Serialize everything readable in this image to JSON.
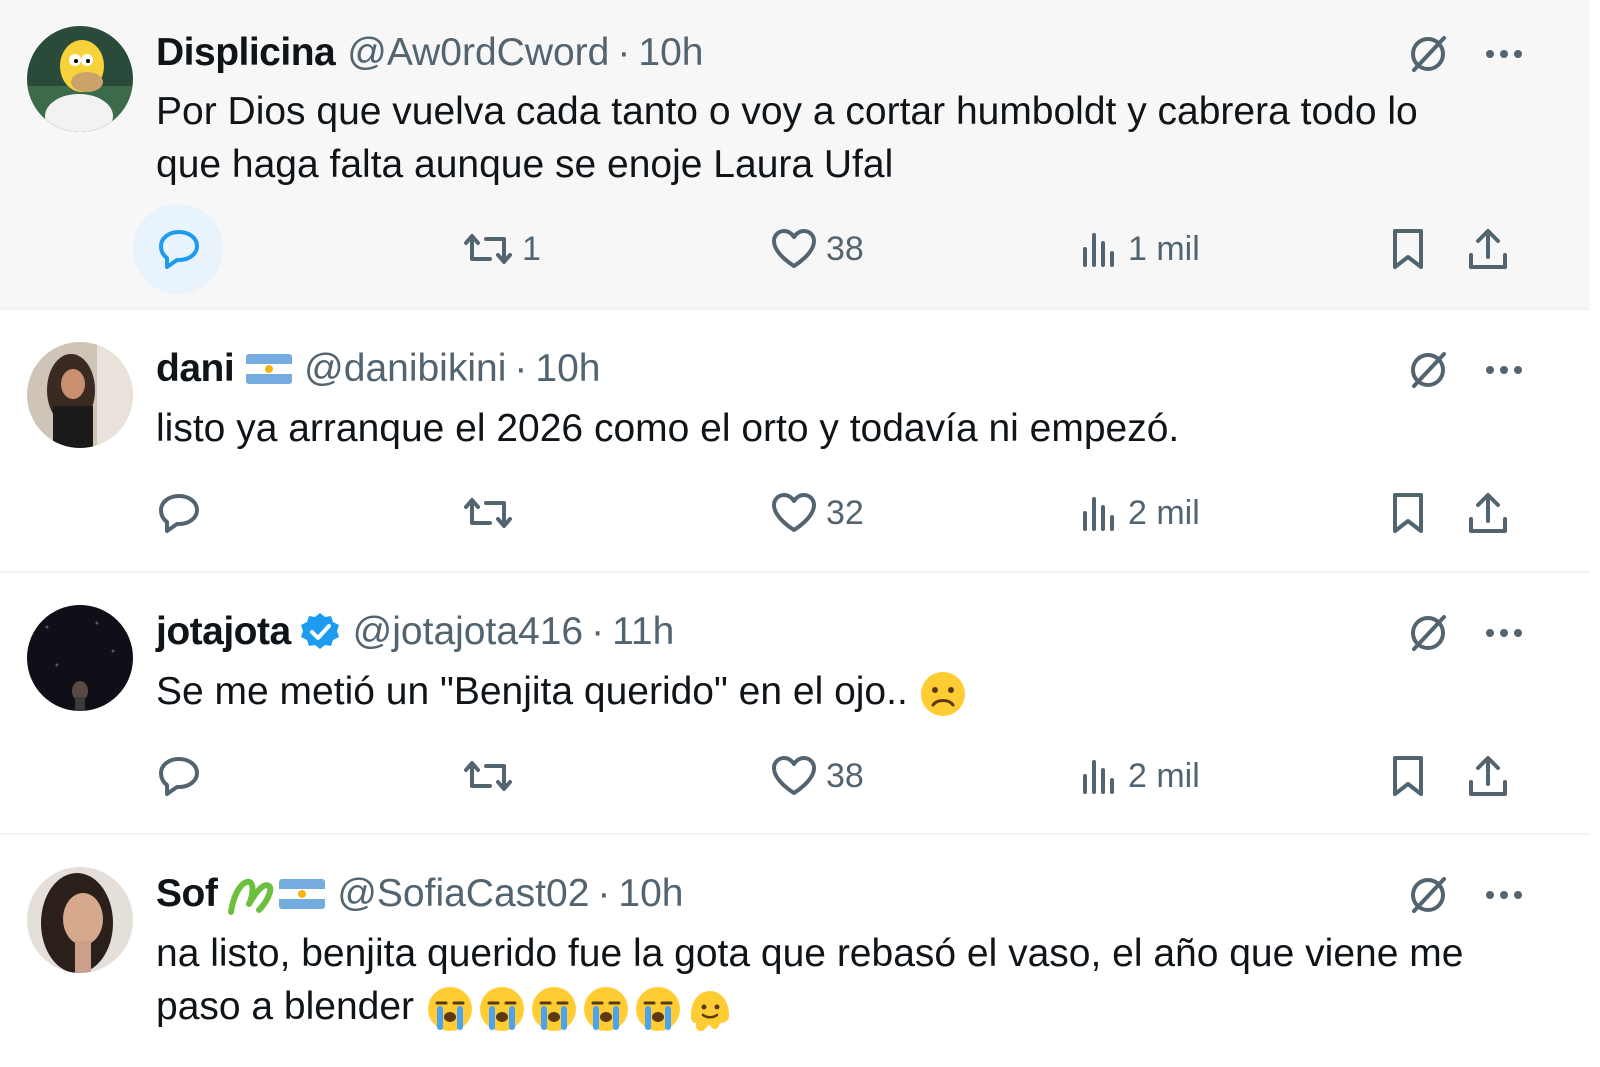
{
  "colors": {
    "accent": "#1d9bf0",
    "secondary_text": "#536471",
    "hover_bg": "#f7f7f7"
  },
  "tweets": [
    {
      "name": "Displicina",
      "handle": "@Aw0rdCword",
      "separator": "·",
      "time": "10h",
      "text_line1": "Por Dios que vuelva cada tanto o voy a cortar humboldt y cabrera todo lo",
      "text_line2": "que haga falta aunque se enoje Laura Ufal",
      "retweets": "1",
      "likes": "38",
      "views": "1 mil",
      "avatar_icon": "homer-avatar-icon"
    },
    {
      "name": "dani",
      "handle": "@danibikini",
      "separator": "·",
      "time": "10h",
      "text_line1": "listo ya arranque el 2026 como el orto y todavía ni empezó.",
      "retweets": "",
      "likes": "32",
      "views": "2 mil",
      "avatar_icon": "photo-avatar-icon"
    },
    {
      "name": "jotajota",
      "handle": "@jotajota416",
      "separator": "·",
      "time": "11h",
      "text_line1": "Se me metió un \"Benjita querido\" en el ojo..",
      "retweets": "",
      "likes": "38",
      "views": "2 mil",
      "avatar_icon": "dark-avatar-icon"
    },
    {
      "name": "Sof",
      "handle": "@SofiaCast02",
      "separator": "·",
      "time": "10h",
      "text_line1": "na listo, benjita querido fue la gota que rebasó el vaso, el año que viene me",
      "text_line2": "paso a blender",
      "avatar_icon": "portrait-avatar-icon"
    }
  ]
}
